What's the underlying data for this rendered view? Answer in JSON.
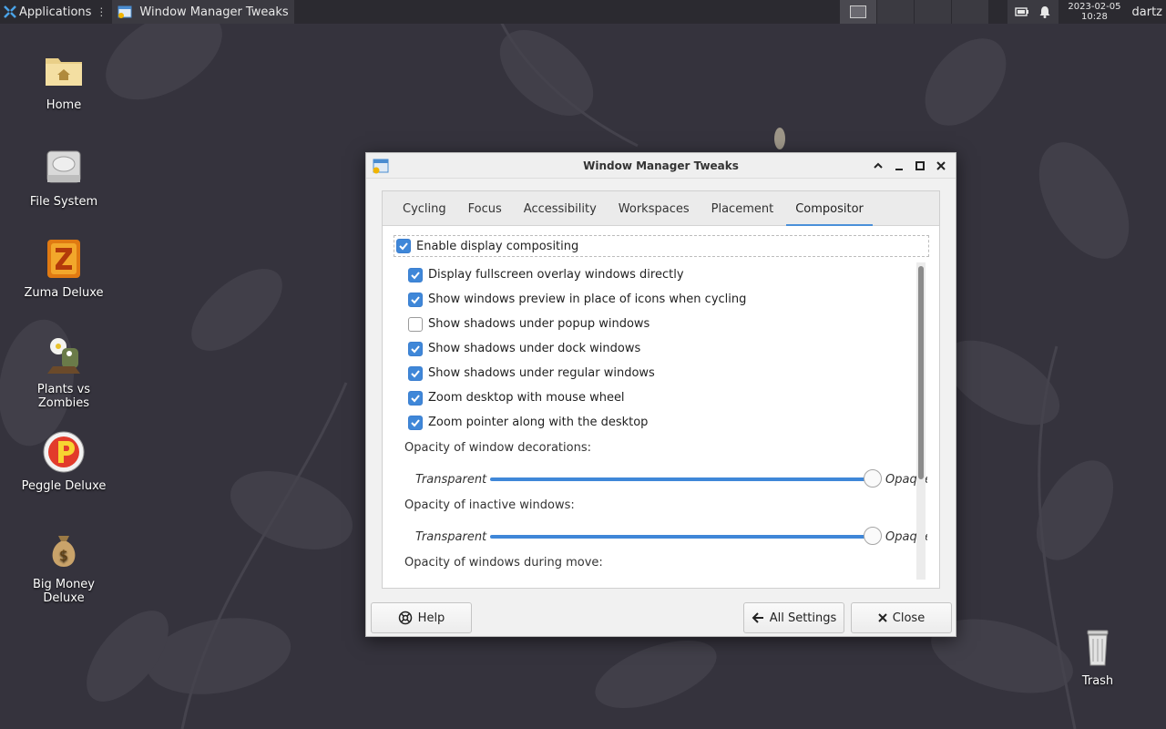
{
  "panel": {
    "applications_label": "Applications",
    "task_label": "Window Manager Tweaks",
    "clock_date": "2023-02-05",
    "clock_time": "10:28",
    "user": "dartz"
  },
  "desktop": {
    "icons": [
      {
        "label": "Home"
      },
      {
        "label": "File System"
      },
      {
        "label": "Zuma Deluxe"
      },
      {
        "label": "Plants vs Zombies"
      },
      {
        "label": "Peggle Deluxe"
      },
      {
        "label": "Big Money Deluxe"
      },
      {
        "label": "Trash"
      }
    ]
  },
  "window": {
    "title": "Window Manager Tweaks",
    "tabs": [
      "Cycling",
      "Focus",
      "Accessibility",
      "Workspaces",
      "Placement",
      "Compositor"
    ],
    "active_tab": "Compositor",
    "enable_compositing": {
      "label": "Enable display compositing",
      "checked": true
    },
    "options": [
      {
        "label": "Display fullscreen overlay windows directly",
        "checked": true
      },
      {
        "label": "Show windows preview in place of icons when cycling",
        "checked": true
      },
      {
        "label": "Show shadows under popup windows",
        "checked": false
      },
      {
        "label": "Show shadows under dock windows",
        "checked": true
      },
      {
        "label": "Show shadows under regular windows",
        "checked": true
      },
      {
        "label": "Zoom desktop with mouse wheel",
        "checked": true
      },
      {
        "label": "Zoom pointer along with the desktop",
        "checked": true
      }
    ],
    "opacity_decorations": {
      "label": "Opacity of window decorations:",
      "low": "Transparent",
      "high": "Opaque",
      "value": 1.0
    },
    "opacity_inactive": {
      "label": "Opacity of inactive windows:",
      "low": "Transparent",
      "high": "Opaque",
      "value": 1.0
    },
    "opacity_move": {
      "label": "Opacity of windows during move:"
    },
    "buttons": {
      "help": "Help",
      "all_settings": "All Settings",
      "close": "Close"
    }
  },
  "colors": {
    "accent": "#3f87d8",
    "panel": "#2b2a30",
    "desktop": "#35333d"
  }
}
